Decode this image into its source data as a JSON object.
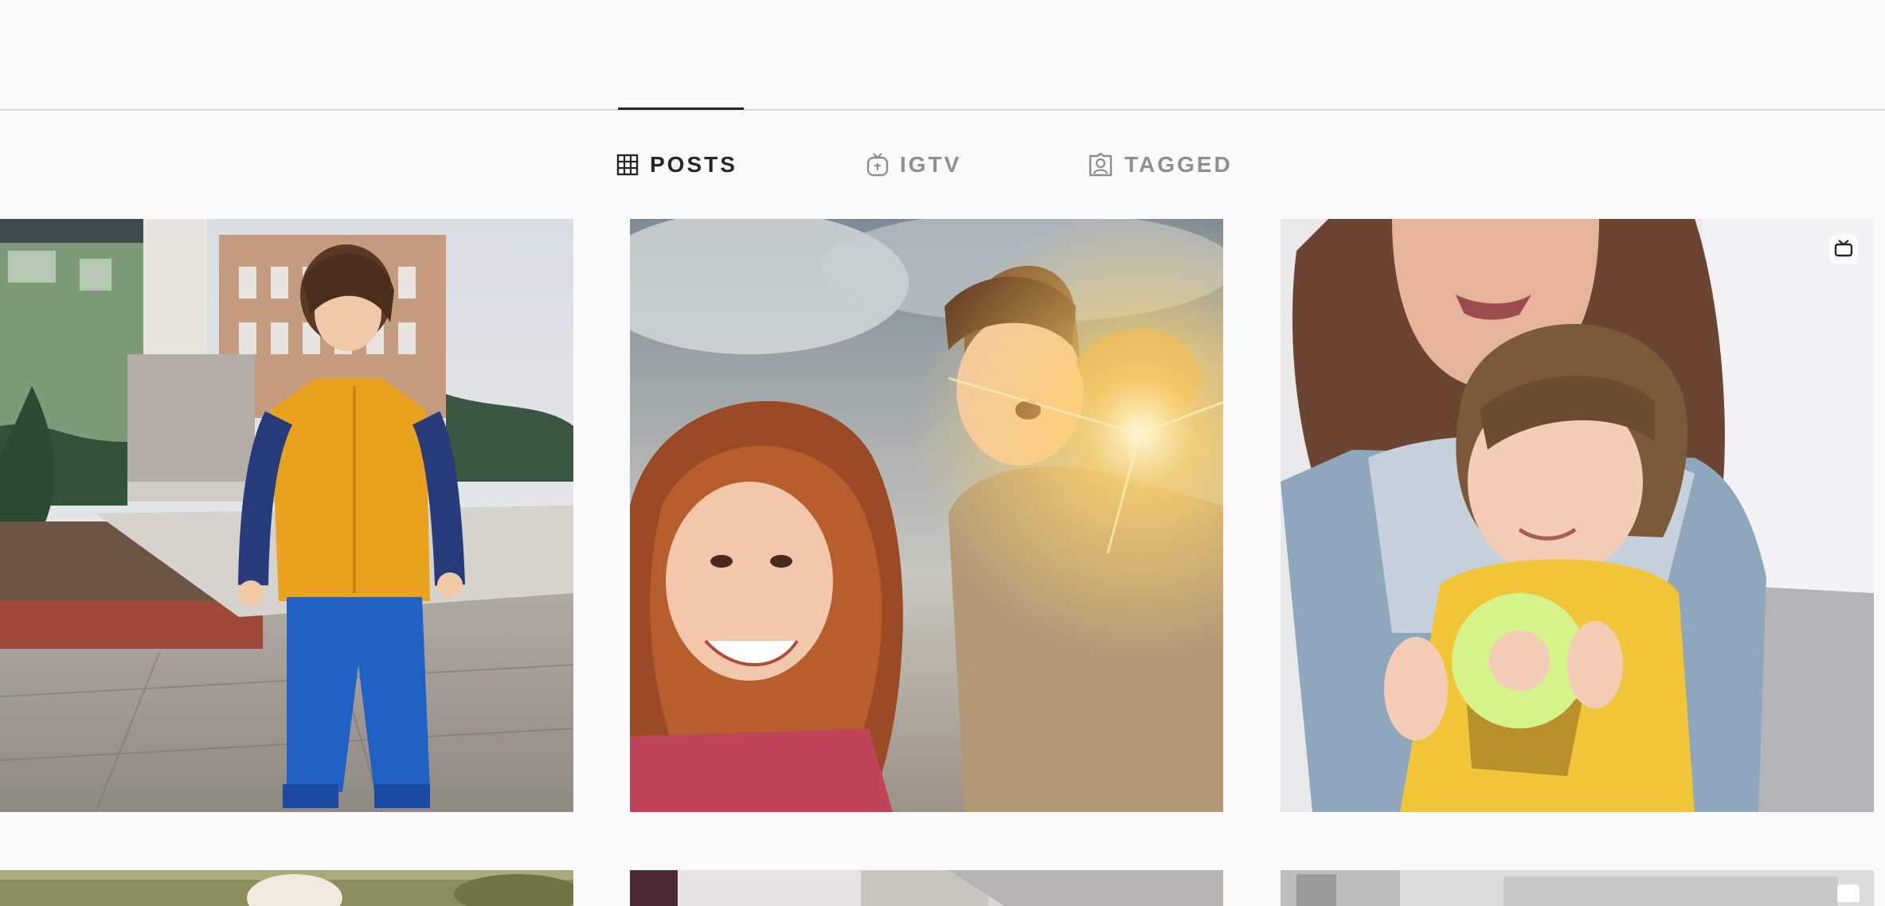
{
  "tabs": [
    {
      "label": "POSTS",
      "icon": "grid-icon",
      "active": true
    },
    {
      "label": "IGTV",
      "icon": "igtv-icon",
      "active": false
    },
    {
      "label": "TAGGED",
      "icon": "tagged-icon",
      "active": false
    }
  ],
  "colors": {
    "background": "#fafafa",
    "divider": "#dbdbdb",
    "active_text": "#262626",
    "inactive_text": "#8e8e8e"
  },
  "grid": {
    "posts": [
      {
        "id": "post-1",
        "icon": "photo",
        "badge": null
      },
      {
        "id": "post-2",
        "icon": "photo",
        "badge": null
      },
      {
        "id": "post-3",
        "icon": "photo",
        "badge": "reel-icon"
      },
      {
        "id": "post-4",
        "icon": "photo",
        "badge": null
      },
      {
        "id": "post-5",
        "icon": "photo",
        "badge": null
      },
      {
        "id": "post-6",
        "icon": "photo",
        "badge": "reel-icon"
      }
    ]
  }
}
